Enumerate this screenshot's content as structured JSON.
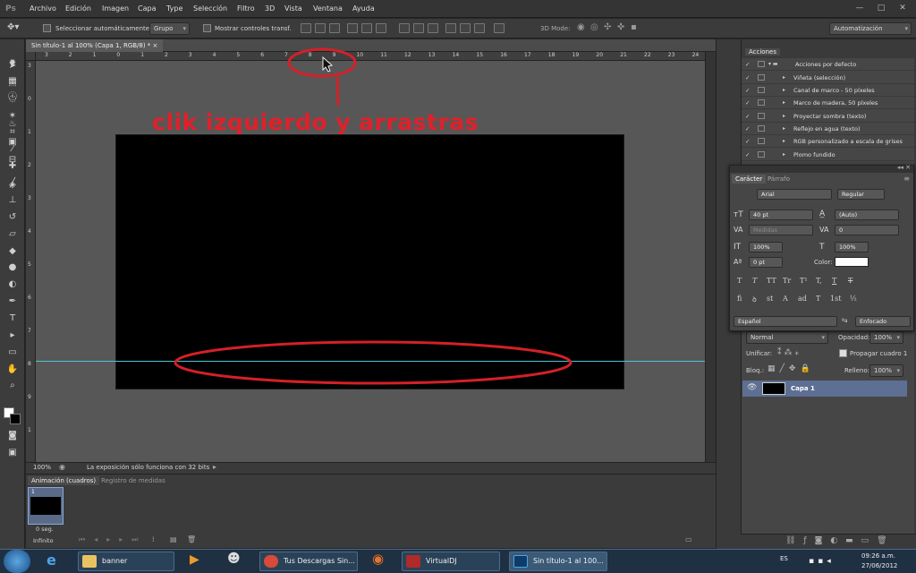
{
  "menu": [
    "Archivo",
    "Edición",
    "Imagen",
    "Capa",
    "Type",
    "Selección",
    "Filtro",
    "3D",
    "Vista",
    "Ventana",
    "Ayuda"
  ],
  "app_logo": "Ps",
  "window_controls": {
    "minimize": "—",
    "maximize": "□",
    "close": "✕"
  },
  "options": {
    "auto_select_label": "Seleccionar automáticamente:",
    "auto_select_value": "Grupo",
    "transform_label": "Mostrar controles transf.",
    "mode3d_label": "3D Mode:",
    "workspace": "Automatización"
  },
  "document": {
    "tab_title": "Sin título-1 al 100% (Capa 1, RGB/8) *",
    "tab_close": "×",
    "ruler_top": [
      "3",
      "2",
      "1",
      "0",
      "1",
      "2",
      "3",
      "4",
      "5",
      "6",
      "7",
      "8",
      "9",
      "10",
      "11",
      "12",
      "13",
      "14",
      "15",
      "16",
      "17",
      "18",
      "19",
      "20",
      "21",
      "22",
      "23",
      "24"
    ],
    "ruler_left": [
      "3",
      "0",
      "1",
      "2",
      "3",
      "4",
      "5",
      "6",
      "7",
      "8",
      "9",
      "1"
    ],
    "zoom": "100%",
    "status": "La exposición sólo funciona con 32 bits"
  },
  "annotation": {
    "text": "clik izquierdo y arrastras",
    "color": "#e0202a"
  },
  "animation": {
    "tabs": [
      "Animación (cuadros)",
      "Registro de medidas"
    ],
    "frame_number": "1",
    "frame_delay": "0 seg.",
    "loop": "Infinito"
  },
  "actions_panel": {
    "title": "Acciones",
    "items": [
      {
        "label": "Acciones por defecto",
        "type": "folder"
      },
      {
        "label": "Viñeta (selección)",
        "type": "action"
      },
      {
        "label": "Canal de marco - 50 píxeles",
        "type": "action"
      },
      {
        "label": "Marco de madera, 50 píxeles",
        "type": "action"
      },
      {
        "label": "Proyectar sombra (texto)",
        "type": "action"
      },
      {
        "label": "Reflejo en agua (texto)",
        "type": "action"
      },
      {
        "label": "RGB personalizado a escala de grises",
        "type": "action"
      },
      {
        "label": "Plomo fundido",
        "type": "action"
      }
    ]
  },
  "character_panel": {
    "tabs": [
      "Carácter",
      "Párrafo"
    ],
    "font_family": "Arial",
    "font_style": "Regular",
    "size": "40 pt",
    "leading": "(Auto)",
    "kerning": "Medidas",
    "tracking": "0",
    "vscale": "100%",
    "hscale": "100%",
    "baseline": "0 pt",
    "color_label": "Color:",
    "color_value": "#ffffff",
    "format_row1": [
      "T",
      "T",
      "TT",
      "Tr",
      "T¹",
      "T,",
      "T",
      "T"
    ],
    "format_row2": [
      "fi",
      "ꝺ",
      "st",
      "A",
      "ad",
      "T",
      "1st",
      "½"
    ],
    "language": "Español",
    "antialias_icon": "ªa",
    "antialias": "Enfocado"
  },
  "layers_panel": {
    "blend": "Normal",
    "opacity_label": "Opacidad:",
    "opacity": "100%",
    "unify_label": "Unificar:",
    "propagate_label": "Propagar cuadro 1",
    "lock_label": "Bloq.:",
    "fill_label": "Relleno:",
    "fill": "100%",
    "layer_name": "Capa 1"
  },
  "taskbar": {
    "items": [
      "banner",
      "Tus Descargas Sin...",
      "VirtualDJ",
      "Sin título-1 al 100..."
    ],
    "lang": "ES",
    "time": "09:26 a.m.",
    "date": "27/06/2012"
  }
}
